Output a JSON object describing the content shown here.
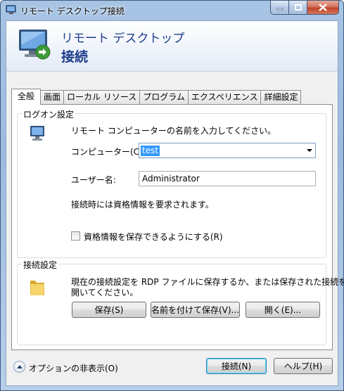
{
  "window": {
    "title": "リモート デスクトップ接続"
  },
  "banner": {
    "line1": "リモート デスクトップ",
    "line2": "接続"
  },
  "tabs": [
    "全般",
    "画面",
    "ローカル リソース",
    "プログラム",
    "エクスペリエンス",
    "詳細設定"
  ],
  "logon": {
    "group_label": "ログオン設定",
    "instruction": "リモート コンピューターの名前を入力してください。",
    "computer_label": "コンピューター(C):",
    "computer_value": "test",
    "user_label": "ユーザー名:",
    "user_value": "Administrator",
    "credential_note": "接続時には資格情報を要求されます。",
    "save_credentials_label": "資格情報を保存できるようにする(R)"
  },
  "connection": {
    "group_label": "接続設定",
    "description_line1": "現在の接続設定を RDP ファイルに保存するか、または保存された接続を",
    "description_line2": "開いてください。",
    "save_button": "保存(S)",
    "save_as_button": "名前を付けて保存(V)...",
    "open_button": "開く(E)..."
  },
  "footer": {
    "options_toggle": "オプションの非表示(O)",
    "connect_button": "接続(N)",
    "help_button": "ヘルプ(H)"
  },
  "colors": {
    "title_blue": "#1c3c8c",
    "selection": "#3399ff",
    "close_red": "#c0432a",
    "default_button_glow": "#48d8fb"
  }
}
